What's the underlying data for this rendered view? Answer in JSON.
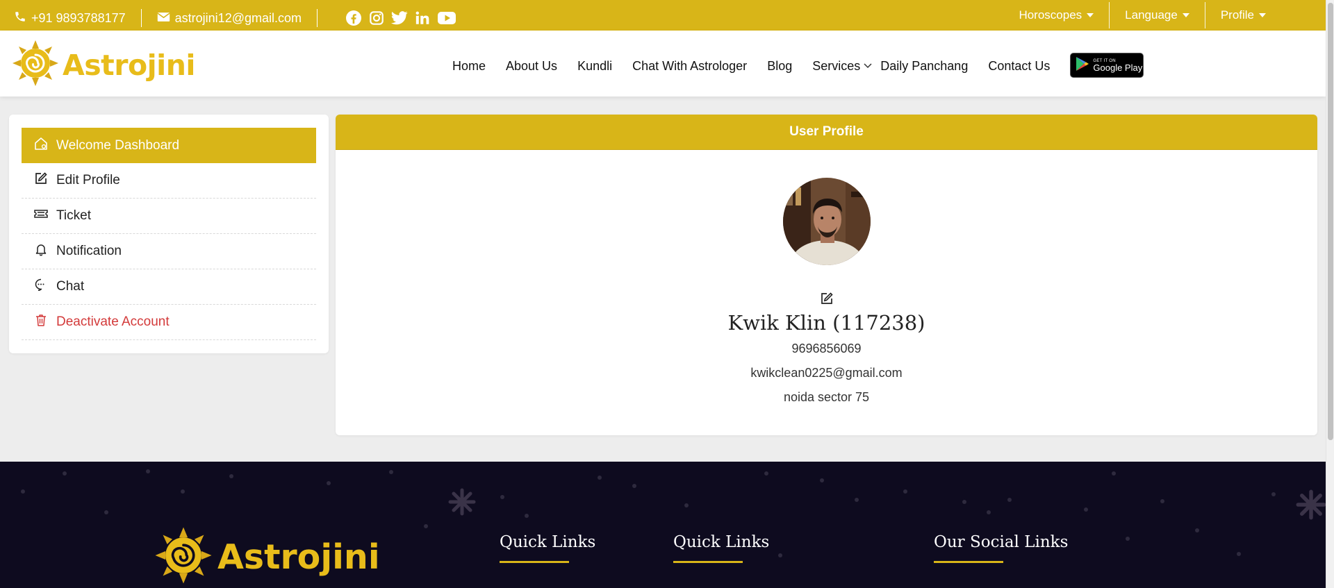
{
  "topbar": {
    "phone": "+91 9893788177",
    "email": "astrojini12@gmail.com",
    "socials": [
      "facebook-icon",
      "instagram-icon",
      "twitter-icon",
      "linkedin-icon",
      "youtube-icon"
    ],
    "dropdowns": [
      "Horoscopes",
      "Language",
      "Profile"
    ]
  },
  "nav": {
    "brand": "Astrojini",
    "items": [
      "Home",
      "About Us",
      "Kundli",
      "Chat With Astrologer",
      "Blog",
      "Services",
      "Daily Panchang",
      "Contact Us"
    ],
    "gplay_small": "GET IT ON",
    "gplay_big": "Google Play"
  },
  "sidebar": {
    "items": [
      {
        "label": "Welcome Dashboard",
        "icon": "home-icon",
        "active": true
      },
      {
        "label": "Edit Profile",
        "icon": "edit-icon"
      },
      {
        "label": "Ticket",
        "icon": "ticket-icon"
      },
      {
        "label": "Notification",
        "icon": "bell-icon"
      },
      {
        "label": "Chat",
        "icon": "chat-icon"
      },
      {
        "label": "Deactivate Account",
        "icon": "trash-icon",
        "danger": true
      }
    ]
  },
  "profile": {
    "title": "User Profile",
    "name": "Kwik Klin (117238)",
    "phone": "9696856069",
    "email": "kwikclean0225@gmail.com",
    "address": "noida sector 75"
  },
  "footer": {
    "brand": "Astrojini",
    "columns": [
      "Quick Links",
      "Quick Links",
      "Our Social Links"
    ]
  },
  "colors": {
    "accent": "#d8b518",
    "brand_text": "#e8bc1a",
    "footer_bg": "#0e0b1f",
    "danger": "#d33a3a"
  }
}
